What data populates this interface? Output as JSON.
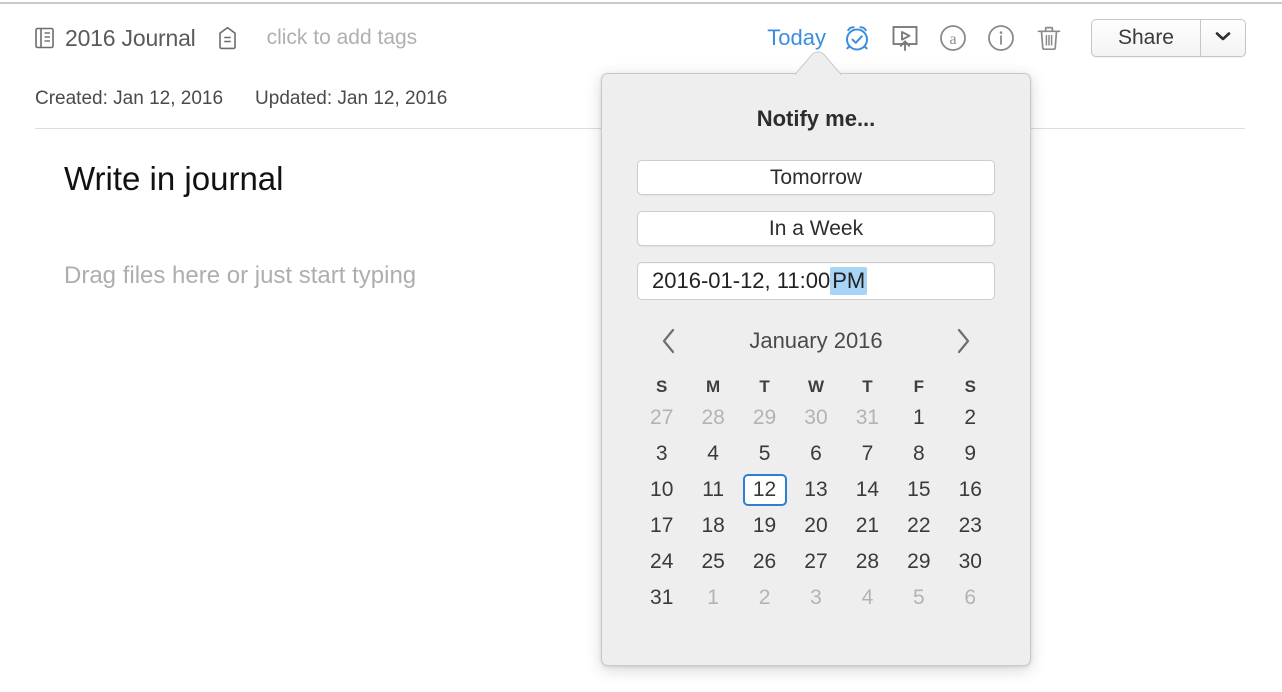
{
  "note_header": {
    "notebook_icon": "notebook-icon",
    "notebook_name": "2016 Journal",
    "tag_icon": "tag-icon",
    "tags_placeholder": "click to add tags"
  },
  "toolbar": {
    "today_label": "Today",
    "reminder_icon": "alarm-clock-check-icon",
    "present_icon": "presentation-play-icon",
    "annotate_icon": "circled-a-icon",
    "info_icon": "circled-info-icon",
    "delete_icon": "trash-icon",
    "share_label": "Share",
    "share_chevron_icon": "chevron-down-icon",
    "accent_color": "#3b8ede"
  },
  "meta": {
    "created": "Created: Jan 12, 2016",
    "updated": "Updated: Jan 12, 2016"
  },
  "note_body": {
    "title": "Write in journal",
    "placeholder": "Drag files here or just start typing"
  },
  "popover": {
    "title": "Notify me...",
    "quick_buttons": [
      {
        "label": "Tomorrow"
      },
      {
        "label": "In a Week"
      }
    ],
    "datetime_field": {
      "value_prefix": "2016-01-12, 11:00 ",
      "value_selected": "PM",
      "selection_color": "#a8d4f5"
    },
    "calendar": {
      "prev_icon": "chevron-left-icon",
      "next_icon": "chevron-right-icon",
      "month_label": "January 2016",
      "weekdays": [
        "S",
        "M",
        "T",
        "W",
        "T",
        "F",
        "S"
      ],
      "selected_day": 12,
      "selected_border_color": "#2b7fd4",
      "weeks": [
        [
          {
            "n": "27",
            "muted": true
          },
          {
            "n": "28",
            "muted": true
          },
          {
            "n": "29",
            "muted": true
          },
          {
            "n": "30",
            "muted": true
          },
          {
            "n": "31",
            "muted": true
          },
          {
            "n": "1",
            "muted": false
          },
          {
            "n": "2",
            "muted": false
          }
        ],
        [
          {
            "n": "3",
            "muted": false
          },
          {
            "n": "4",
            "muted": false
          },
          {
            "n": "5",
            "muted": false
          },
          {
            "n": "6",
            "muted": false
          },
          {
            "n": "7",
            "muted": false
          },
          {
            "n": "8",
            "muted": false
          },
          {
            "n": "9",
            "muted": false
          }
        ],
        [
          {
            "n": "10",
            "muted": false
          },
          {
            "n": "11",
            "muted": false
          },
          {
            "n": "12",
            "muted": false,
            "selected": true
          },
          {
            "n": "13",
            "muted": false
          },
          {
            "n": "14",
            "muted": false
          },
          {
            "n": "15",
            "muted": false
          },
          {
            "n": "16",
            "muted": false
          }
        ],
        [
          {
            "n": "17",
            "muted": false
          },
          {
            "n": "18",
            "muted": false
          },
          {
            "n": "19",
            "muted": false
          },
          {
            "n": "20",
            "muted": false
          },
          {
            "n": "21",
            "muted": false
          },
          {
            "n": "22",
            "muted": false
          },
          {
            "n": "23",
            "muted": false
          }
        ],
        [
          {
            "n": "24",
            "muted": false
          },
          {
            "n": "25",
            "muted": false
          },
          {
            "n": "26",
            "muted": false
          },
          {
            "n": "27",
            "muted": false
          },
          {
            "n": "28",
            "muted": false
          },
          {
            "n": "29",
            "muted": false
          },
          {
            "n": "30",
            "muted": false
          }
        ],
        [
          {
            "n": "31",
            "muted": false
          },
          {
            "n": "1",
            "muted": true
          },
          {
            "n": "2",
            "muted": true
          },
          {
            "n": "3",
            "muted": true
          },
          {
            "n": "4",
            "muted": true
          },
          {
            "n": "5",
            "muted": true
          },
          {
            "n": "6",
            "muted": true
          }
        ]
      ]
    }
  }
}
